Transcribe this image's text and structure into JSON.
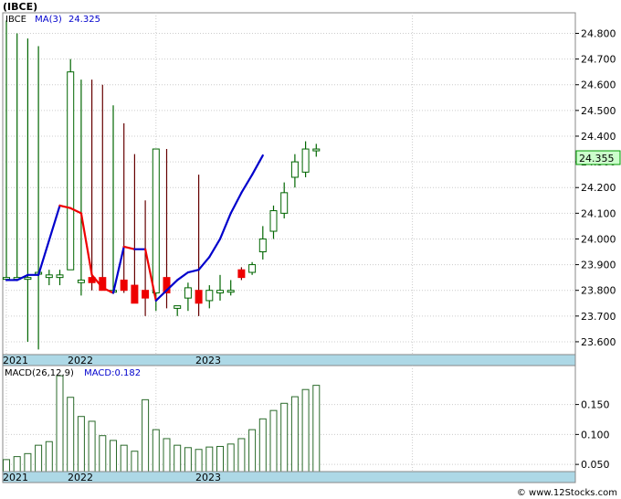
{
  "title": "(IBCE)",
  "footer": "© www.12Stocks.com",
  "colors": {
    "up": "#006600",
    "down": "#ee0000",
    "ma_up": "#0000cc",
    "ma_down": "#ee0000",
    "wick": "#660000",
    "macd_bar": "#2a6a2a",
    "axis_strip": "#add8e6",
    "price_tag_bg": "#ccffcc",
    "grid": "#cccccc"
  },
  "chart_data": [
    {
      "type": "candlestick",
      "legend": {
        "ticker": "IBCE",
        "ma_label": "MA(3)",
        "ma_value": "24.325"
      },
      "ylim": [
        23.55,
        24.88
      ],
      "yticks": [
        "24.800",
        "24.700",
        "24.600",
        "24.500",
        "24.400",
        "24.300",
        "24.200",
        "24.100",
        "24.000",
        "23.900",
        "23.800",
        "23.700",
        "23.600"
      ],
      "last_price": "24.355",
      "x_labels": [
        "2021",
        "2022",
        "2023"
      ],
      "x_label_index": [
        0,
        14,
        38
      ],
      "candles": [
        {
          "o": 23.85,
          "h": 24.85,
          "l": 23.85,
          "c": 23.85
        },
        {
          "o": 23.85,
          "h": 24.8,
          "l": 23.85,
          "c": 23.85
        },
        {
          "o": 23.85,
          "h": 24.78,
          "l": 23.6,
          "c": 23.85
        },
        {
          "o": 23.87,
          "h": 24.75,
          "l": 23.57,
          "c": 23.87
        },
        {
          "o": 23.85,
          "h": 23.88,
          "l": 23.82,
          "c": 23.86
        },
        {
          "o": 23.85,
          "h": 23.88,
          "l": 23.82,
          "c": 23.86
        },
        {
          "o": 23.88,
          "h": 24.7,
          "l": 23.88,
          "c": 24.65
        },
        {
          "o": 23.83,
          "h": 24.62,
          "l": 23.78,
          "c": 23.84
        },
        {
          "o": 23.85,
          "h": 24.62,
          "l": 23.8,
          "c": 23.83
        },
        {
          "o": 23.85,
          "h": 24.6,
          "l": 23.8,
          "c": 23.8
        },
        {
          "o": 23.8,
          "h": 24.52,
          "l": 23.8,
          "c": 23.8
        },
        {
          "o": 23.84,
          "h": 24.45,
          "l": 23.79,
          "c": 23.8
        },
        {
          "o": 23.82,
          "h": 24.33,
          "l": 23.76,
          "c": 23.75
        },
        {
          "o": 23.8,
          "h": 24.15,
          "l": 23.7,
          "c": 23.77
        },
        {
          "o": 23.79,
          "h": 24.35,
          "l": 23.72,
          "c": 24.35
        },
        {
          "o": 23.85,
          "h": 24.35,
          "l": 23.73,
          "c": 23.79
        },
        {
          "o": 23.73,
          "h": 23.74,
          "l": 23.7,
          "c": 23.74
        },
        {
          "o": 23.77,
          "h": 23.83,
          "l": 23.72,
          "c": 23.81
        },
        {
          "o": 23.8,
          "h": 24.25,
          "l": 23.7,
          "c": 23.75
        },
        {
          "o": 23.76,
          "h": 23.82,
          "l": 23.73,
          "c": 23.8
        },
        {
          "o": 23.79,
          "h": 23.86,
          "l": 23.76,
          "c": 23.8
        },
        {
          "o": 23.8,
          "h": 23.84,
          "l": 23.78,
          "c": 23.8
        },
        {
          "o": 23.88,
          "h": 23.89,
          "l": 23.84,
          "c": 23.85
        },
        {
          "o": 23.87,
          "h": 23.91,
          "l": 23.86,
          "c": 23.9
        },
        {
          "o": 23.95,
          "h": 24.05,
          "l": 23.92,
          "c": 24.0
        },
        {
          "o": 24.03,
          "h": 24.13,
          "l": 24.0,
          "c": 24.11
        },
        {
          "o": 24.1,
          "h": 24.22,
          "l": 24.08,
          "c": 24.18
        },
        {
          "o": 24.24,
          "h": 24.33,
          "l": 24.2,
          "c": 24.3
        },
        {
          "o": 24.26,
          "h": 24.38,
          "l": 24.24,
          "c": 24.35
        },
        {
          "o": 24.35,
          "h": 24.37,
          "l": 24.32,
          "c": 24.35
        }
      ],
      "ma": [
        23.84,
        23.84,
        23.86,
        23.86,
        24.13,
        24.12,
        24.1,
        23.86,
        23.81,
        23.79,
        23.97,
        23.96,
        23.96,
        23.76,
        23.8,
        23.84,
        23.87,
        23.88,
        23.93,
        24.0,
        24.1,
        24.18,
        24.25,
        24.325
      ]
    },
    {
      "type": "bar",
      "legend": {
        "name": "MACD(26,12,9)",
        "value_label": "MACD:0.182"
      },
      "ylim": [
        0.038,
        0.215
      ],
      "yticks": [
        "0.150",
        "0.100",
        "0.050"
      ],
      "x_labels": [
        "2021",
        "2022",
        "2023"
      ],
      "values": [
        0.058,
        0.063,
        0.068,
        0.082,
        0.088,
        0.198,
        0.162,
        0.13,
        0.122,
        0.098,
        0.09,
        0.082,
        0.072,
        0.158,
        0.108,
        0.093,
        0.082,
        0.078,
        0.075,
        0.079,
        0.08,
        0.084,
        0.093,
        0.108,
        0.126,
        0.14,
        0.152,
        0.163,
        0.175,
        0.182
      ]
    }
  ]
}
